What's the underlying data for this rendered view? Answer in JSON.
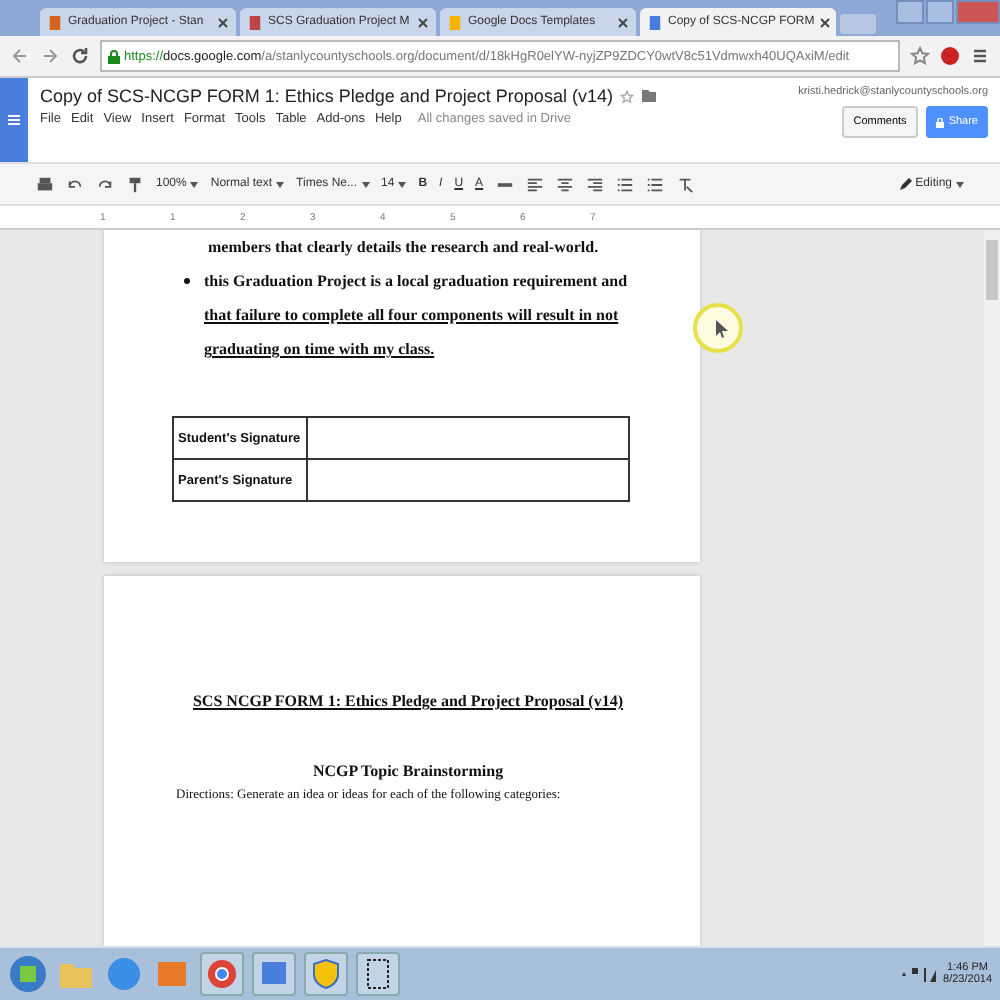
{
  "browser": {
    "tabs": [
      {
        "title": "Graduation Project - Stan",
        "selected": false
      },
      {
        "title": "SCS Graduation Project M",
        "selected": false
      },
      {
        "title": "Google Docs Templates",
        "selected": false
      },
      {
        "title": "Copy of SCS-NCGP FORM",
        "selected": true
      }
    ],
    "url_scheme": "https://",
    "url_host": "docs.google.com",
    "url_path": "/a/stanlycountyschools.org/document/d/18kHgR0elYW-nyjZP9ZDCY0wtV8c51Vdmwxh40UQAxiM/edit"
  },
  "docs": {
    "title": "Copy of SCS-NCGP FORM 1: Ethics Pledge and Project Proposal (v14)",
    "account": "kristi.hedrick@stanlycountyschools.org",
    "menu": [
      "File",
      "Edit",
      "View",
      "Insert",
      "Format",
      "Tools",
      "Table",
      "Add-ons",
      "Help"
    ],
    "save_status": "All changes saved in Drive",
    "comments_button": "Comments",
    "share_button": "Share",
    "toolbar": {
      "zoom": "100%",
      "style": "Normal text",
      "font": "Times Ne...",
      "size": "14",
      "bold": "B",
      "italic": "I",
      "underline": "U",
      "text_color": "A",
      "mode": "Editing"
    },
    "ruler_marks": [
      "1",
      "1",
      "2",
      "3",
      "4",
      "5",
      "6",
      "7"
    ]
  },
  "page1": {
    "line": "members that clearly details the research and real-world.",
    "bullet": {
      "text": "this Graduation Project is a local graduation requirement and ",
      "underlined_text": "that failure to complete all four components will result in not graduating on time with my class."
    },
    "signatures": [
      {
        "label": "Student's Signature"
      },
      {
        "label": "Parent's Signature"
      }
    ]
  },
  "page2": {
    "heading": "SCS NCGP  FORM 1:  Ethics Pledge and Project Proposal (v14)",
    "subheading": "NCGP  Topic Brainstorming",
    "directions": "Directions:  Generate an idea or ideas for each of the following categories:"
  },
  "taskbar": {
    "time": "1:46 PM",
    "date": "8/23/2014"
  }
}
